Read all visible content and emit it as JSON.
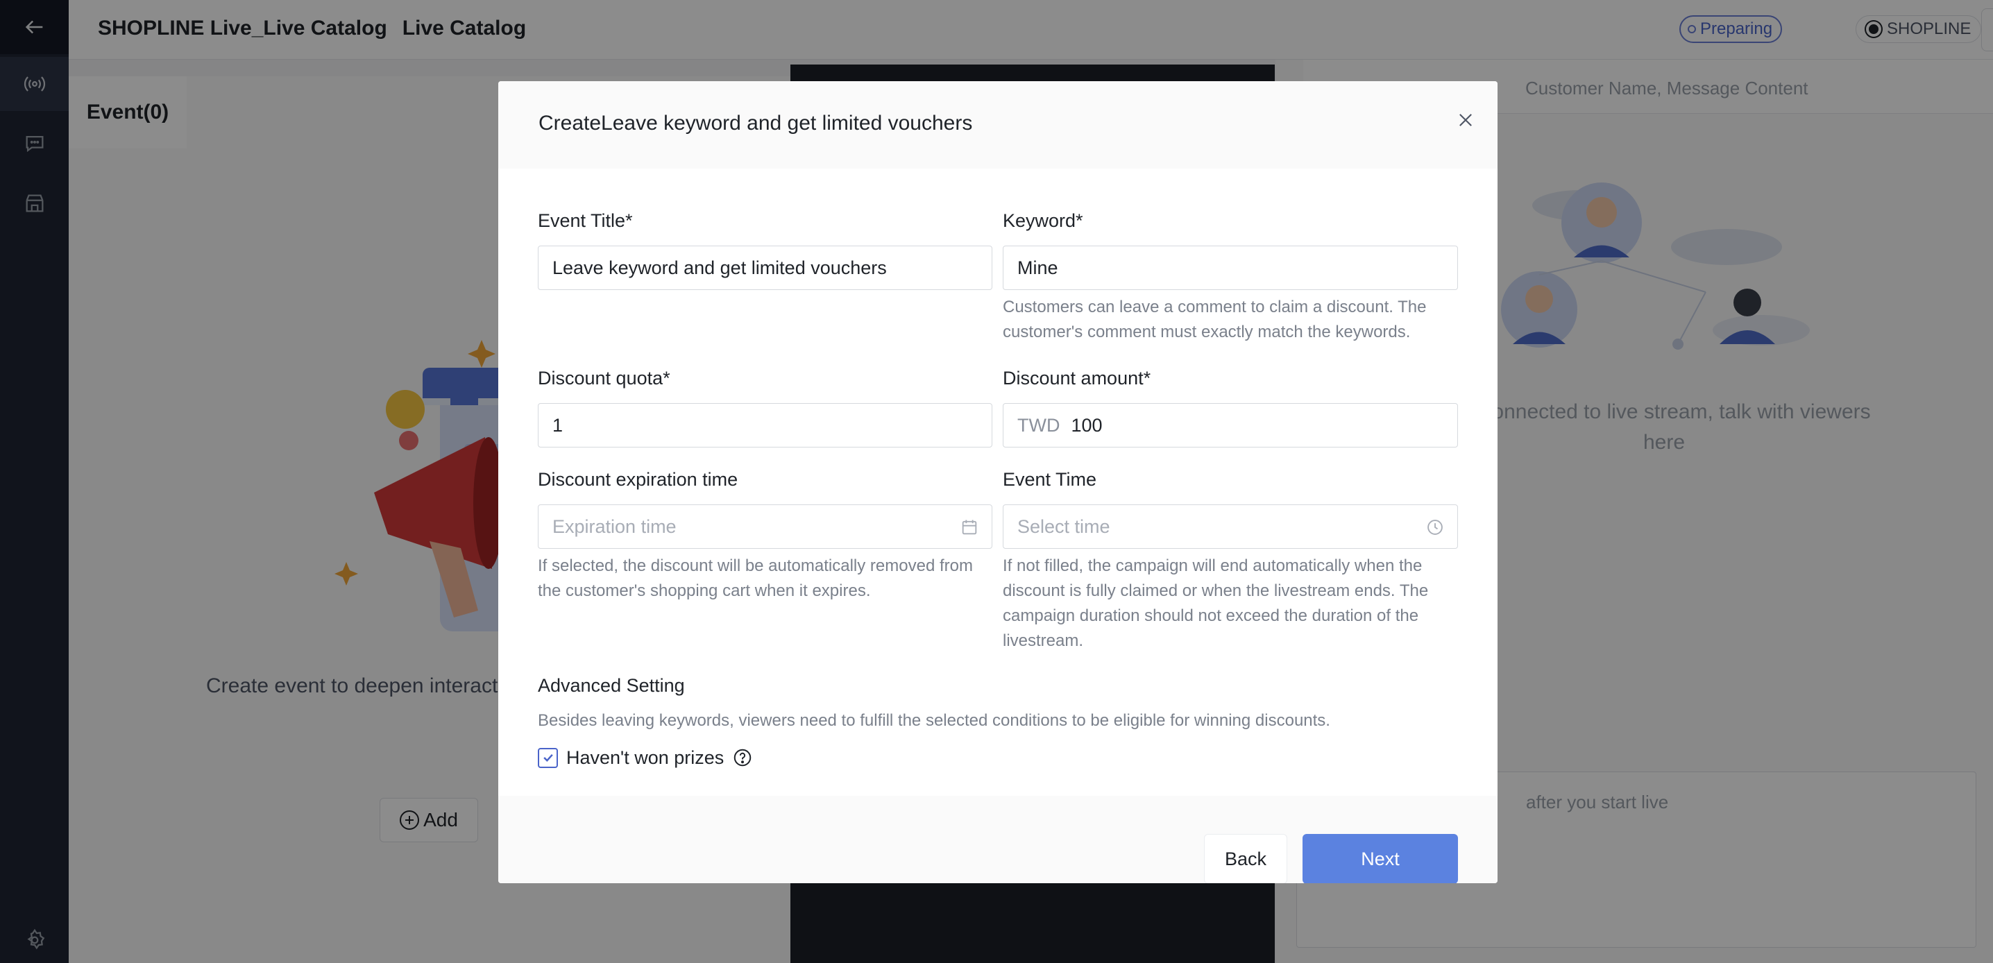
{
  "header": {
    "title": "SHOPLINE Live_Live Catalog",
    "subtitle": "Live Catalog",
    "status": "Preparing",
    "brand": "SHOPLINE"
  },
  "left_panel": {
    "tab": "Event(0)",
    "empty_text": "Create event to deepen interact",
    "add_label": "Add"
  },
  "right_panel": {
    "search_placeholder": "Customer Name, Message Content",
    "hint": "er connected to live stream, talk with viewers here",
    "composer_placeholder": "after you start live"
  },
  "modal": {
    "title": "CreateLeave keyword and get limited vouchers",
    "event_title": {
      "label": "Event Title*",
      "value": "Leave keyword and get limited vouchers"
    },
    "keyword": {
      "label": "Keyword*",
      "value": "Mine",
      "help": "Customers can leave a comment to claim a discount. The customer's comment must exactly match the keywords."
    },
    "discount_quota": {
      "label": "Discount quota*",
      "value": "1"
    },
    "discount_amount": {
      "label": "Discount amount*",
      "currency": "TWD",
      "value": "100"
    },
    "expiration": {
      "label": "Discount expiration time",
      "placeholder": "Expiration time",
      "help": "If selected, the discount will be automatically removed from the customer's shopping cart when it expires."
    },
    "event_time": {
      "label": "Event Time",
      "placeholder": "Select time",
      "help": "If not filled, the campaign will end automatically when the discount is fully claimed or when the livestream ends. The campaign duration should not exceed the duration of the livestream."
    },
    "advanced": {
      "title": "Advanced Setting",
      "desc": "Besides leaving keywords, viewers need to fulfill the selected conditions to be eligible for winning discounts.",
      "option_label": "Haven't won prizes",
      "option_checked": true
    },
    "back_label": "Back",
    "next_label": "Next"
  },
  "colors": {
    "accent": "#5b82e0",
    "sidebar": "#1f2533",
    "overlay": "rgba(0,0,0,0.45)"
  }
}
